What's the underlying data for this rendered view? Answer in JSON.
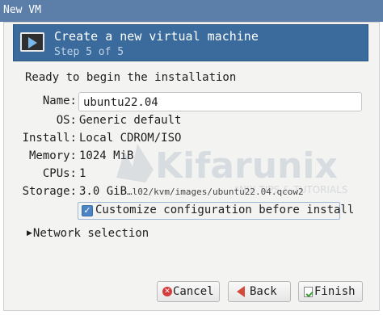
{
  "window": {
    "title": "New VM"
  },
  "header": {
    "icon": "monitor-play-icon",
    "title": "Create a new virtual machine",
    "step": "Step 5 of 5"
  },
  "summary": {
    "ready_text": "Ready to begin the installation",
    "name_label": "Name:",
    "name_value": "ubuntu22.04",
    "os_label": "OS:",
    "os_value": "Generic default",
    "install_label": "Install:",
    "install_value": "Local CDROM/ISO",
    "memory_label": "Memory:",
    "memory_value": "1024 MiB",
    "cpus_label": "CPUs:",
    "cpus_value": "1",
    "storage_label": "Storage:",
    "storage_size": "3.0 GiB",
    "storage_path": "…l02/kvm/images/ubuntu22.04.qcow2"
  },
  "customize": {
    "checked": true,
    "label": "Customize configuration before install"
  },
  "network": {
    "expander": "Network selection"
  },
  "buttons": {
    "cancel": "Cancel",
    "back": "Back",
    "finish": "Finish"
  },
  "watermark": {
    "text": "Kifarunix",
    "tagline": "*NIX TIPS & TUTORIALS"
  }
}
